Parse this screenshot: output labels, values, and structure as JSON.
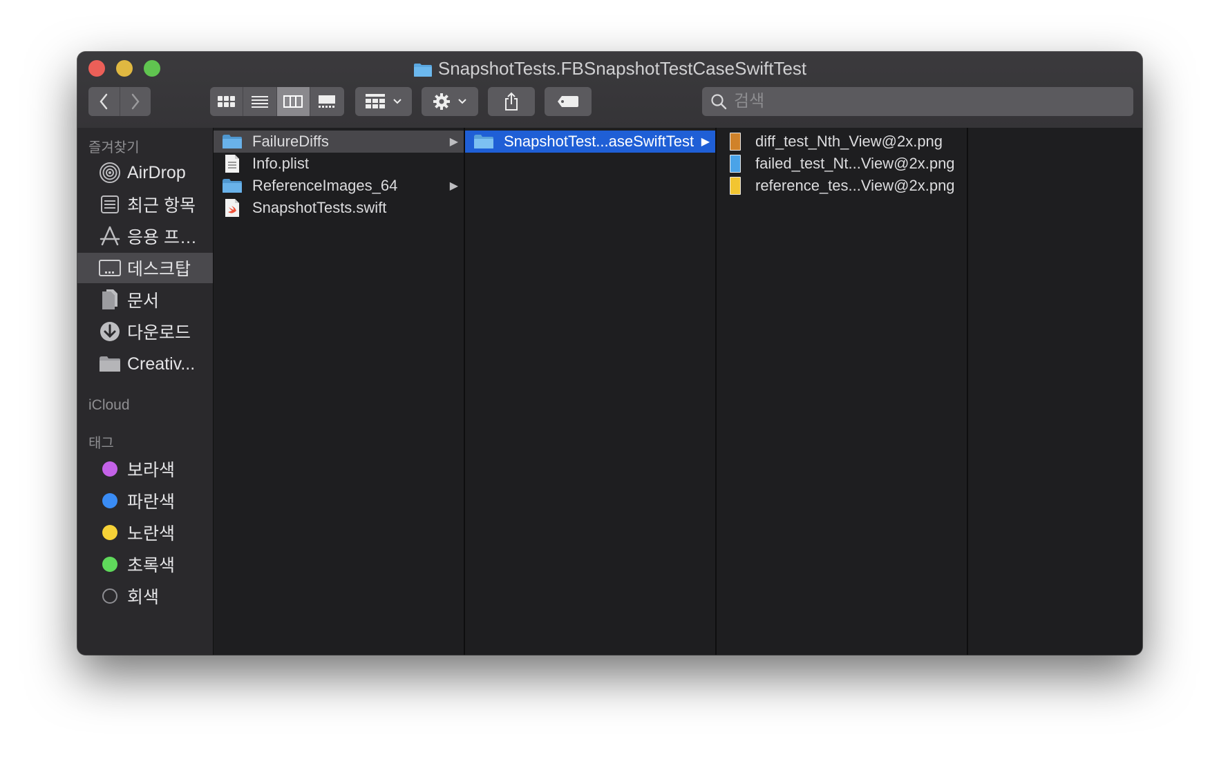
{
  "window": {
    "title": "SnapshotTests.FBSnapshotTestCaseSwiftTest"
  },
  "search": {
    "placeholder": "검색"
  },
  "sidebar": {
    "favorites_header": "즐겨찾기",
    "favorites": [
      {
        "label": "AirDrop",
        "icon": "airdrop-icon"
      },
      {
        "label": "최근 항목",
        "icon": "recents-icon"
      },
      {
        "label": "응용 프…",
        "icon": "applications-icon"
      },
      {
        "label": "데스크탑",
        "icon": "desktop-icon"
      },
      {
        "label": "문서",
        "icon": "documents-icon"
      },
      {
        "label": "다운로드",
        "icon": "downloads-icon"
      },
      {
        "label": "Creativ...",
        "icon": "folder-icon"
      }
    ],
    "icloud_header": "iCloud",
    "tags_header": "태그",
    "tags": [
      {
        "label": "보라색",
        "color": "#c462e8"
      },
      {
        "label": "파란색",
        "color": "#3a8cf5"
      },
      {
        "label": "노란색",
        "color": "#f6d237"
      },
      {
        "label": "초록색",
        "color": "#5fd95b"
      },
      {
        "label": "회색",
        "color": "#8e8e93"
      }
    ]
  },
  "columns": [
    {
      "items": [
        {
          "label": "FailureDiffs",
          "icon": "folder-icon",
          "has_children": true,
          "arrow": "▶"
        },
        {
          "label": "Info.plist",
          "icon": "plist-file-icon",
          "has_children": false
        },
        {
          "label": "ReferenceImages_64",
          "icon": "folder-icon",
          "has_children": true,
          "arrow": "▶"
        },
        {
          "label": "SnapshotTests.swift",
          "icon": "swift-file-icon",
          "has_children": false
        }
      ]
    },
    {
      "items": [
        {
          "label": "SnapshotTest...aseSwiftTest",
          "icon": "folder-icon",
          "has_children": true,
          "arrow": "▶"
        }
      ]
    },
    {
      "items": [
        {
          "label": "diff_test_Nth_View@2x.png",
          "icon": "png-file-icon",
          "color": "#d0822a"
        },
        {
          "label": "failed_test_Nt...View@2x.png",
          "icon": "png-file-icon",
          "color": "#4aa3e8"
        },
        {
          "label": "reference_tes...View@2x.png",
          "icon": "png-file-icon",
          "color": "#f2c531"
        }
      ]
    }
  ]
}
